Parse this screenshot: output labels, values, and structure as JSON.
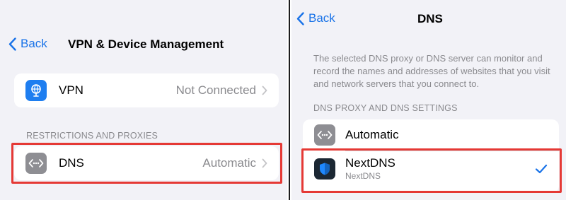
{
  "left": {
    "back_label": "Back",
    "title": "VPN & Device Management",
    "vpn_row": {
      "label": "VPN",
      "value": "Not Connected",
      "icon": "vpn-icon"
    },
    "section_header": "RESTRICTIONS AND PROXIES",
    "dns_row": {
      "label": "DNS",
      "value": "Automatic",
      "icon": "dns-icon"
    }
  },
  "right": {
    "back_label": "Back",
    "title": "DNS",
    "description": "The selected DNS proxy or DNS server can monitor and record the names and addresses of websites that you visit and network servers that you connect to.",
    "section_header": "DNS PROXY AND DNS SETTINGS",
    "options": [
      {
        "label": "Automatic",
        "icon": "dns-icon"
      },
      {
        "label": "NextDNS",
        "sublabel": "NextDNS",
        "icon": "nextdns-shield-icon",
        "selected": true
      }
    ]
  },
  "colors": {
    "accent": "#1a73e8",
    "highlight": "#e53935",
    "secondary_text": "#8a8a8e",
    "background": "#f2f2f7"
  }
}
